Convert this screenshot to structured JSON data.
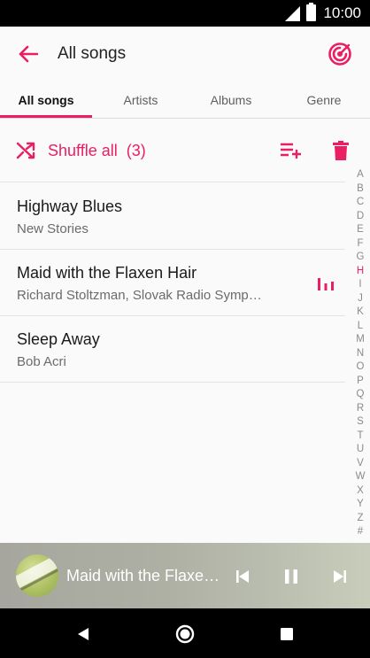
{
  "status_bar": {
    "time": "10:00"
  },
  "app_bar": {
    "title": "All songs"
  },
  "tabs": [
    {
      "label": "All songs",
      "active": true
    },
    {
      "label": "Artists",
      "active": false
    },
    {
      "label": "Albums",
      "active": false
    },
    {
      "label": "Genre",
      "active": false
    }
  ],
  "actions": {
    "shuffle_label": "Shuffle all",
    "shuffle_count": "(3)"
  },
  "songs": [
    {
      "title": "Highway Blues",
      "artist": "New Stories",
      "playing": false
    },
    {
      "title": "Maid with the Flaxen Hair",
      "artist": "Richard Stoltzman, Slovak Radio Symp…",
      "playing": true
    },
    {
      "title": "Sleep Away",
      "artist": "Bob Acri",
      "playing": false
    }
  ],
  "alphabet_index": {
    "letters": [
      "A",
      "B",
      "C",
      "D",
      "E",
      "F",
      "G",
      "H",
      "I",
      "J",
      "K",
      "L",
      "M",
      "N",
      "O",
      "P",
      "Q",
      "R",
      "S",
      "T",
      "U",
      "V",
      "W",
      "X",
      "Y",
      "Z",
      "#"
    ],
    "active": "H"
  },
  "now_playing": {
    "title": "Maid with the Flaxen Hair"
  },
  "colors": {
    "accent": "#e91e63",
    "status_bar": "#000000",
    "background": "#fafafa"
  },
  "icons": {
    "back": "arrow-left-icon",
    "podcast": "podcast-icon",
    "shuffle": "shuffle-icon",
    "add_to_queue": "playlist-add-icon",
    "delete": "trash-icon",
    "equalizer": "equalizer-icon",
    "previous": "skip-previous-icon",
    "pause": "pause-icon",
    "next": "skip-next-icon"
  }
}
